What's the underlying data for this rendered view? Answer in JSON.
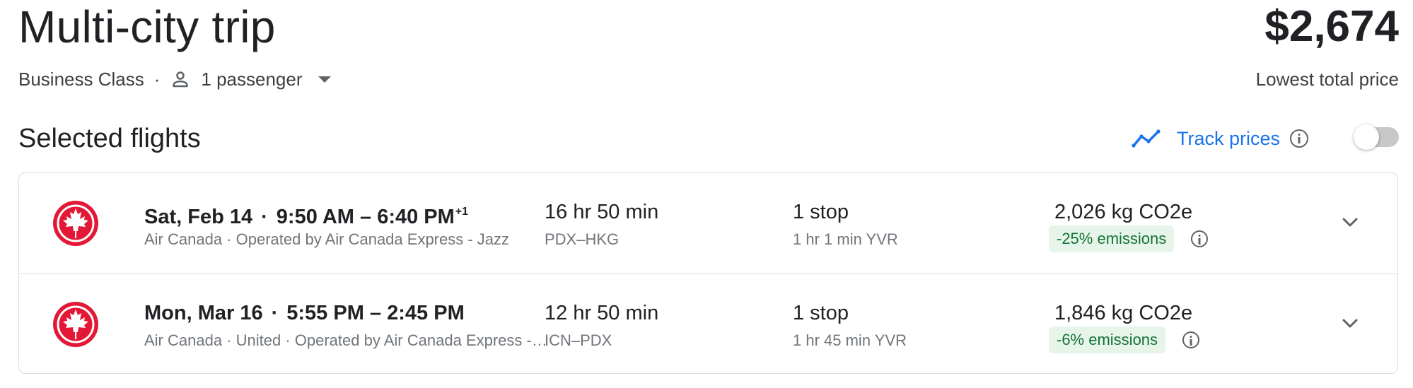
{
  "header": {
    "title": "Multi-city trip",
    "price": "$2,674",
    "cabin_class": "Business Class",
    "separator": "·",
    "passengers": "1 passenger",
    "price_caption": "Lowest total price"
  },
  "section": {
    "title": "Selected flights",
    "track_label": "Track prices",
    "track_enabled": false
  },
  "colors": {
    "accent": "#1a73e8",
    "airline_red": "#e31837",
    "emissions_bg": "#e6f4ea",
    "emissions_text": "#137333"
  },
  "icons": [
    "person-icon",
    "caret-down-icon",
    "trend-line-icon",
    "info-icon",
    "air-canada-logo",
    "chevron-down-icon"
  ],
  "flights": [
    {
      "date": "Sat, Feb 14",
      "depart": "9:50 AM",
      "dash": "–",
      "arrive": "6:40 PM",
      "day_offset": "+1",
      "airline": "Air Canada · Operated by Air Canada Express - Jazz",
      "duration": "16 hr 50 min",
      "route": "PDX–HKG",
      "stops": "1 stop",
      "layover": "1 hr 1 min YVR",
      "co2": "2,026 kg CO2e",
      "emissions": "-25% emissions"
    },
    {
      "date": "Mon, Mar 16",
      "depart": "5:55 PM",
      "dash": "–",
      "arrive": "2:45 PM",
      "day_offset": "",
      "airline": "Air Canada · United · Operated by Air Canada Express - Jazz",
      "duration": "12 hr 50 min",
      "route": "ICN–PDX",
      "stops": "1 stop",
      "layover": "1 hr 45 min YVR",
      "co2": "1,846 kg CO2e",
      "emissions": "-6% emissions"
    }
  ]
}
